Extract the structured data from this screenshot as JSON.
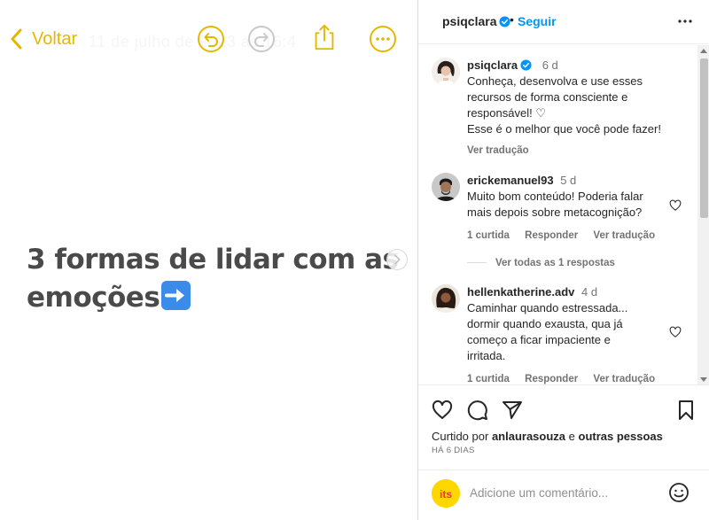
{
  "image": {
    "back_label": "Voltar",
    "ghost_date": "11 de julho de 2023 às 16:4",
    "title_line1": "3 formas de lidar com as",
    "title_line2": "emoções"
  },
  "header": {
    "username": "psiqclara",
    "separator": "•",
    "follow_label": "Seguir"
  },
  "caption": {
    "username": "psiqclara",
    "time": "6 d",
    "line1": "Conheça, desenvolva e use esses",
    "line2": "recursos de forma consciente e",
    "line3": "responsável! ♡",
    "line4": "Esse é o melhor que você pode fazer!",
    "translate": "Ver tradução"
  },
  "comments": [
    {
      "username": "erickemanuel93",
      "time": "5 d",
      "text": "Muito bom conteúdo! Poderia falar mais depois sobre metacognição?",
      "likes": "1 curtida",
      "reply": "Responder",
      "translate": "Ver tradução",
      "view_replies": "Ver todas as 1 respostas"
    },
    {
      "username": "hellenkatherine.adv",
      "time": "4 d",
      "text": "Caminhar quando estressada... dormir quando exausta, qua já começo a ficar impaciente e irritada.",
      "likes": "1 curtida",
      "reply": "Responder",
      "translate": "Ver tradução"
    }
  ],
  "actions": {
    "liked_by_prefix": "Curtido por",
    "liked_by_user": "anlaurasouza",
    "liked_by_and": "e",
    "liked_by_others": "outras pessoas",
    "post_time": "HÁ 6 DIAS"
  },
  "composer": {
    "placeholder": "Adicione um comentário...",
    "avatar_text": "its"
  },
  "colors": {
    "accent_yellow": "#e5b800",
    "link_blue": "#0095f6",
    "emoji_blue": "#3b8be8"
  }
}
